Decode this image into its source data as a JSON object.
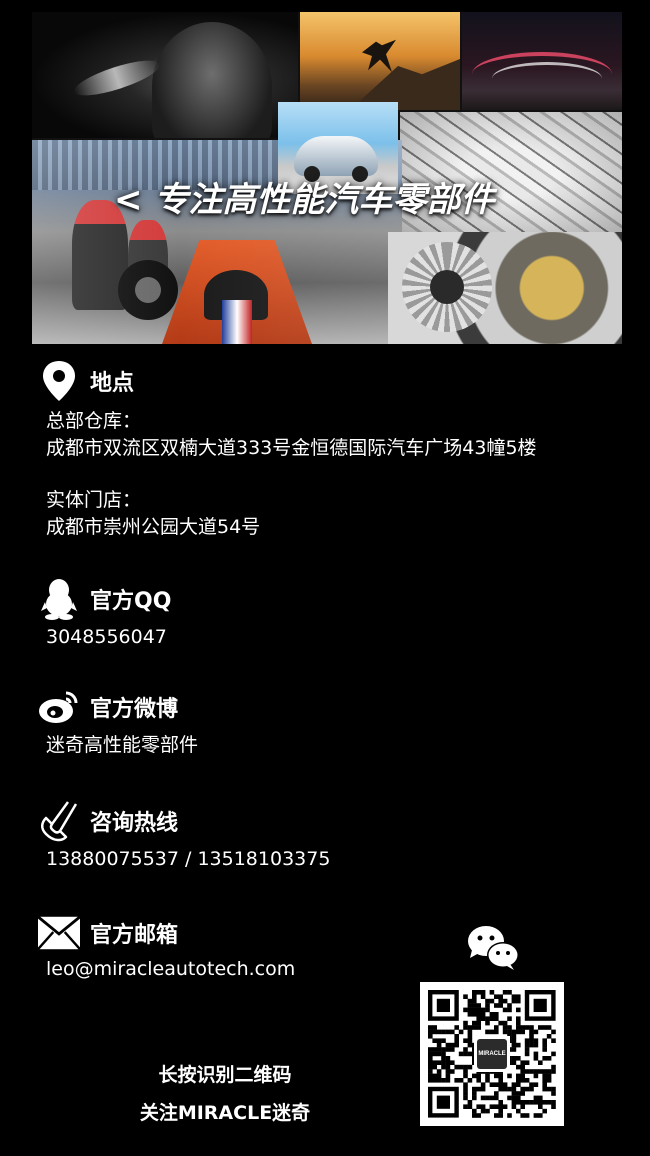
{
  "banner": {
    "title": "< 专注高性能汽车零部件"
  },
  "location": {
    "title": "地点",
    "hq_label": "总部仓库：",
    "hq_address": "成都市双流区双楠大道333号金恒德国际汽车广场43幢5楼",
    "store_label": "实体门店：",
    "store_address": "成都市崇州公园大道54号"
  },
  "qq": {
    "title": "官方QQ",
    "value": "3048556047"
  },
  "weibo": {
    "title": "官方微博",
    "value": "迷奇高性能零部件"
  },
  "hotline": {
    "title": "咨询热线",
    "value": "13880075537 / 13518103375"
  },
  "email": {
    "title": "官方邮箱",
    "value": "leo@miracleautotech.com"
  },
  "qr": {
    "caption_line1": "长按识别二维码",
    "caption_line2": "关注MIRACLE迷奇",
    "badge_text": "MIRACLE"
  },
  "icons": {
    "location": "location-pin-icon",
    "qq": "qq-penguin-icon",
    "weibo": "weibo-icon",
    "phone": "phone-icon",
    "mail": "envelope-icon",
    "wechat": "wechat-icon"
  },
  "colors": {
    "background": "#000000",
    "text": "#ffffff"
  }
}
